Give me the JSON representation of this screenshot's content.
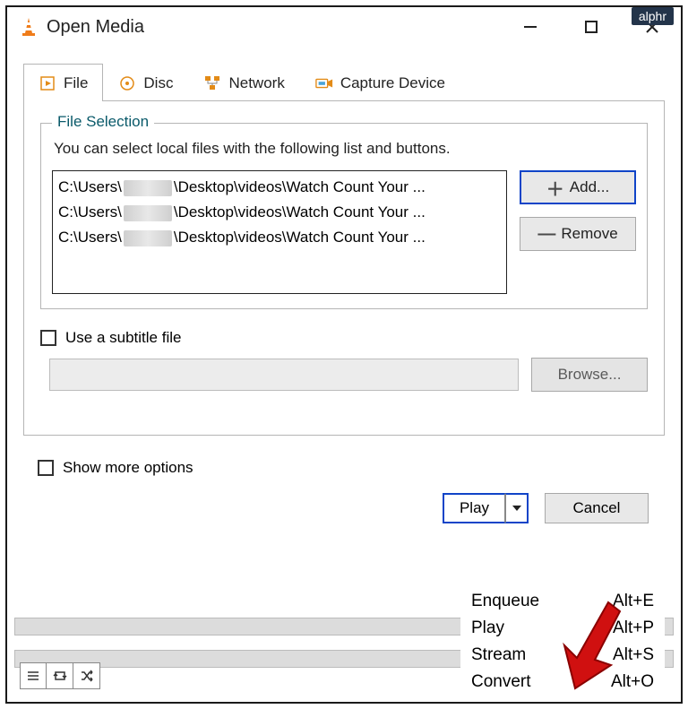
{
  "watermark": "alphr",
  "titlebar": {
    "title": "Open Media"
  },
  "tabs": {
    "file": "File",
    "disc": "Disc",
    "network": "Network",
    "capture": "Capture Device"
  },
  "file_selection": {
    "legend": "File Selection",
    "help": "You can select local files with the following list and buttons.",
    "items": [
      {
        "prefix": "C:\\Users\\",
        "suffix": "\\Desktop\\videos\\Watch Count Your ..."
      },
      {
        "prefix": "C:\\Users\\",
        "suffix": "\\Desktop\\videos\\Watch Count Your ..."
      },
      {
        "prefix": "C:\\Users\\",
        "suffix": "\\Desktop\\videos\\Watch Count Your ..."
      }
    ],
    "add_label": "Add...",
    "remove_label": "Remove"
  },
  "subtitle": {
    "checkbox_label": "Use a subtitle file",
    "browse_label": "Browse..."
  },
  "show_more_label": "Show more options",
  "actions": {
    "play_label": "Play",
    "cancel_label": "Cancel"
  },
  "menu": {
    "items": [
      {
        "label": "Enqueue",
        "shortcut": "Alt+E"
      },
      {
        "label": "Play",
        "shortcut": "Alt+P"
      },
      {
        "label": "Stream",
        "shortcut": "Alt+S"
      },
      {
        "label": "Convert",
        "shortcut": "Alt+O"
      }
    ]
  }
}
